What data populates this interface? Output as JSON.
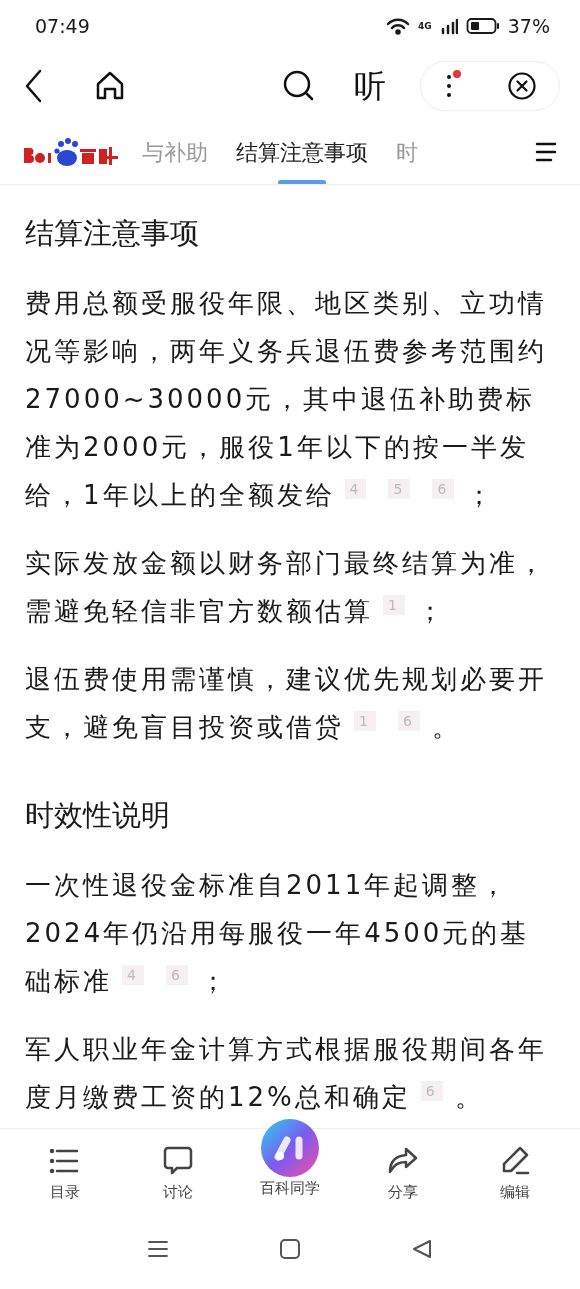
{
  "status_bar": {
    "time": "07:49",
    "network": "4G",
    "battery": "37%"
  },
  "toolbar": {
    "listen": "听"
  },
  "tabs": [
    {
      "label": "与补助",
      "selected": false
    },
    {
      "label": "结算注意事项",
      "selected": true
    },
    {
      "label": "时",
      "selected": false
    }
  ],
  "sections": [
    {
      "heading": "结算注意事项",
      "paragraphs": [
        {
          "text": "费用总额受服役年限、地区类别、立功情况等影响，两年义务兵退伍费参考范围约27000~30000元，其中退伍补助费标准为2000元，服役1年以下的按一半发给，1年以上的全额发给",
          "refs": [
            "4",
            "5",
            "6"
          ],
          "end": "；"
        },
        {
          "text": "实际发放金额以财务部门最终结算为准，需避免轻信非官方数额估算",
          "refs": [
            "1"
          ],
          "end": "；"
        },
        {
          "text": "退伍费使用需谨慎，建议优先规划必要开支，避免盲目投资或借贷",
          "refs": [
            "1",
            "6"
          ],
          "end": "。"
        }
      ]
    },
    {
      "heading": "时效性说明",
      "paragraphs": [
        {
          "text": "一次性退役金标准自2011年起调整，2024年仍沿用每服役一年4500元的基础标准",
          "refs": [
            "4",
            "6"
          ],
          "end": "；"
        },
        {
          "text": "军人职业年金计算方式根据服役期间各年度月缴费工资的12%总和确定",
          "refs": [
            "6"
          ],
          "end": "。"
        }
      ]
    }
  ],
  "bottom_nav": [
    {
      "kind": "list",
      "label": "目录"
    },
    {
      "kind": "comment",
      "label": "讨论"
    },
    {
      "kind": "ai",
      "label": "百科同学"
    },
    {
      "kind": "share",
      "label": "分享"
    },
    {
      "kind": "edit",
      "label": "编辑"
    }
  ]
}
